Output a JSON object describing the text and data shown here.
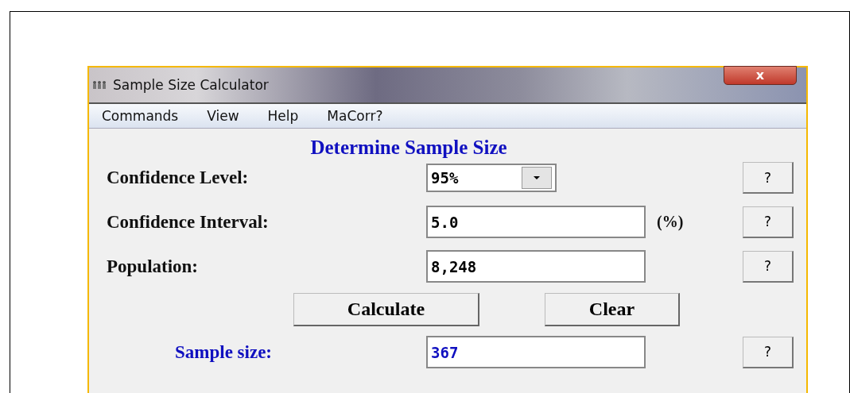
{
  "window": {
    "title": "Sample Size Calculator",
    "close_label": "x"
  },
  "menu": [
    "Commands",
    "View",
    "Help",
    "MaCorr?"
  ],
  "heading": "Determine Sample Size",
  "fields": [
    {
      "kind": "dropdown",
      "label": "Confidence Level:",
      "value": "95%",
      "help": "?"
    },
    {
      "kind": "text",
      "label": "Confidence Interval:",
      "value": "5.0",
      "suffix": "(%)",
      "help": "?"
    },
    {
      "kind": "text",
      "label": "Population:",
      "value": "8,248",
      "help": "?"
    }
  ],
  "buttons": [
    "Calculate",
    "Clear"
  ],
  "result": {
    "label": "Sample size:",
    "value": "367",
    "help": "?"
  }
}
